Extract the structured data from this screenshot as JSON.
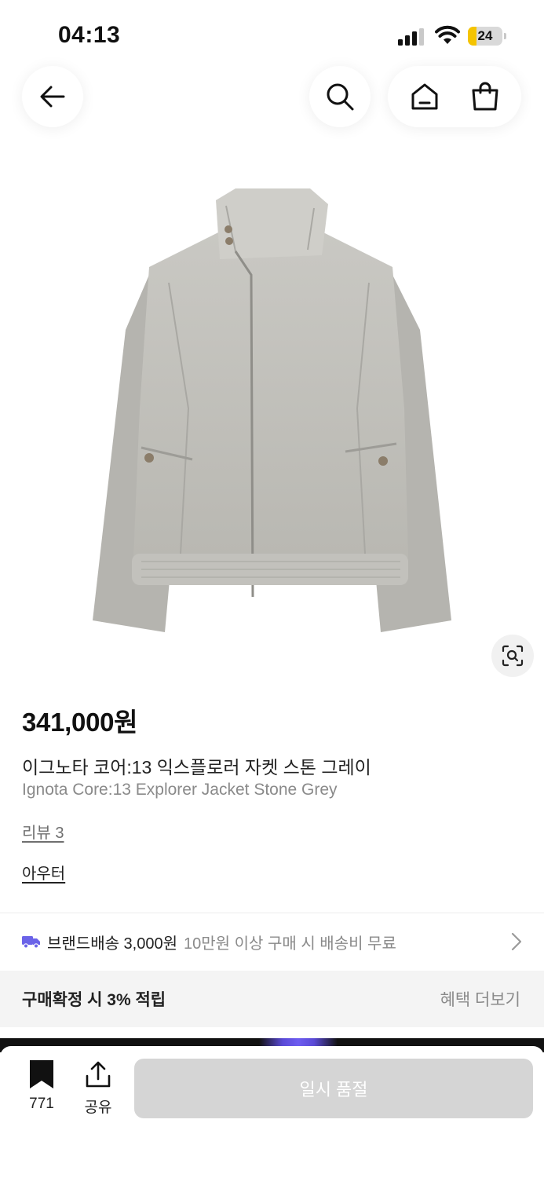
{
  "status_bar": {
    "time": "04:13",
    "battery_level": "24",
    "battery_fraction": 0.24
  },
  "nav": {
    "back_icon": "arrow-left-icon",
    "search_icon": "search-icon",
    "home_icon": "home-icon",
    "cart_icon": "shopping-bag-icon"
  },
  "product": {
    "image_icon": "jacket-photo",
    "lens_icon": "visual-search-icon",
    "price": "341,000원",
    "name_ko": "이그노타 코어:13 익스플로러 자켓 스톤 그레이",
    "name_en": "Ignota Core:13 Explorer Jacket Stone Grey",
    "review_link": "리뷰 3",
    "category_link": "아우터"
  },
  "shipping": {
    "icon": "truck-icon",
    "main": "브랜드배송 3,000원",
    "sub": "10만원 이상 구매 시 배송비 무료"
  },
  "benefit": {
    "main": "구매확정 시 3% 적립",
    "more": "혜택 더보기"
  },
  "bottom_bar": {
    "bookmark_count": "771",
    "share_label": "공유",
    "soldout_label": "일시 품절"
  },
  "colors": {
    "accent_truck": "#6b63e8",
    "battery_yellow": "#f5c400",
    "soldout_bg": "#d5d5d5"
  }
}
